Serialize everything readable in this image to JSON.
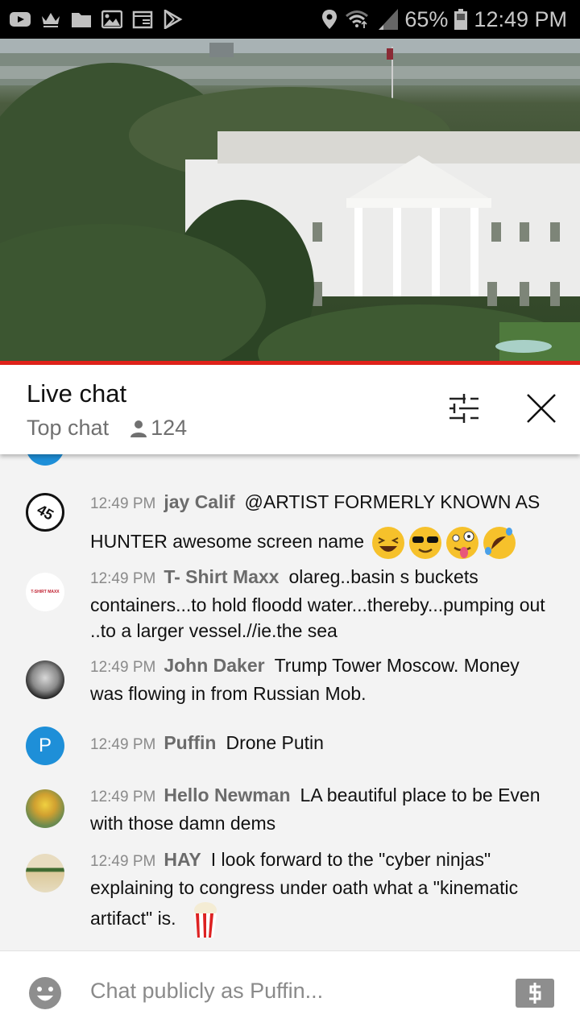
{
  "status_bar": {
    "left_icons": [
      "youtube-icon",
      "crown-icon",
      "folder-icon",
      "gallery-icon",
      "news-icon",
      "play-store-icon"
    ],
    "right_icons": [
      "location-icon",
      "wifi-icon",
      "signal-icon"
    ],
    "battery": "65%",
    "time": "12:49 PM"
  },
  "video": {
    "description": "Live stream view of the White House",
    "progress_fraction": 1.0,
    "progress_color": "#e0221b"
  },
  "chat_header": {
    "title": "Live chat",
    "mode": "Top chat",
    "viewer_count": "124"
  },
  "messages": [
    {
      "time": "12:49 PM",
      "author": "jay Calif",
      "text": "@ARTIST FORMERLY KNOWN AS HUNTER awesome screen name",
      "emojis": [
        "grinning-squinting-face",
        "smiling-face-with-sunglasses",
        "zany-face",
        "rolling-on-floor-laughing"
      ],
      "avatar": "45-badge"
    },
    {
      "time": "12:49 PM",
      "author": "T- Shirt Maxx",
      "text": "olareg..basin s buckets containers...to hold floodd water...thereby...pumping out ..to a larger vessel.//ie.the sea",
      "avatar_label": "T-SHIRT MAXX"
    },
    {
      "time": "12:49 PM",
      "author": "John Daker",
      "text": "Trump Tower Moscow. Money was flowing in from Russian Mob.",
      "avatar": "photo"
    },
    {
      "time": "12:49 PM",
      "author": "Puffin",
      "text": "Drone Putin",
      "avatar_letter": "P",
      "avatar_color": "#1e8fd8"
    },
    {
      "time": "12:49 PM",
      "author": "Hello Newman",
      "text": "LA beautiful place to be Even with those damn dems",
      "avatar": "cartoon"
    },
    {
      "time": "12:49 PM",
      "author": "HAY",
      "text": "I look forward to the \"cyber ninjas\" explaining to congress under oath what a \"kinematic artifact\" is.",
      "emojis": [
        "popcorn"
      ],
      "avatar": "haybale-photo"
    }
  ],
  "input_bar": {
    "placeholder": "Chat publicly as Puffin...",
    "left_icon": "emoji-icon",
    "right_icon": "super-chat-dollar-icon"
  }
}
